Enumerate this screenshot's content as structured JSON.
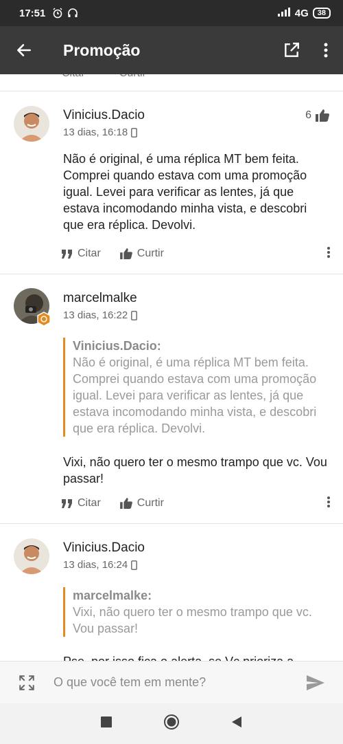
{
  "status_bar": {
    "time": "17:51",
    "network": "4G",
    "battery": "38"
  },
  "app_bar": {
    "title": "Promoção"
  },
  "partial_actions": {
    "quote": "Citar",
    "like": "Curtir"
  },
  "posts": [
    {
      "username": "Vinicius.Dacio",
      "timestamp": "13 dias, 16:18",
      "likes": "6",
      "body": "Não é original, é uma réplica MT bem feita. Comprei quando estava com uma promoção igual. Levei para verificar as lentes, já que estava incomodando minha vista, e descobri que era réplica. Devolvi.",
      "quote_label": "Citar",
      "like_label": "Curtir"
    },
    {
      "username": "marcelmalke",
      "timestamp": "13 dias, 16:22",
      "quote_author": "Vinicius.Dacio:",
      "quote_text": "Não é original, é uma réplica MT bem feita. Comprei quando estava com uma promoção igual. Levei para verificar as lentes, já que estava incomodando minha vista, e descobri que era réplica. Devolvi.",
      "body": "Vixi, não quero ter o mesmo trampo que vc. Vou passar!",
      "quote_label": "Citar",
      "like_label": "Curtir"
    },
    {
      "username": "Vinicius.Dacio",
      "timestamp": "13 dias, 16:24",
      "quote_author": "marcelmalke:",
      "quote_text": "Vixi, não quero ter o mesmo trampo que vc. Vou passar!",
      "body": "Pse, por isso fica o alerta, se Vc prioriza a"
    }
  ],
  "composer": {
    "placeholder": "O que você tem em mente?"
  },
  "colors": {
    "accent": "#e58a1f",
    "appbar": "#3a3a3a",
    "statusbar": "#2b2b2b"
  }
}
